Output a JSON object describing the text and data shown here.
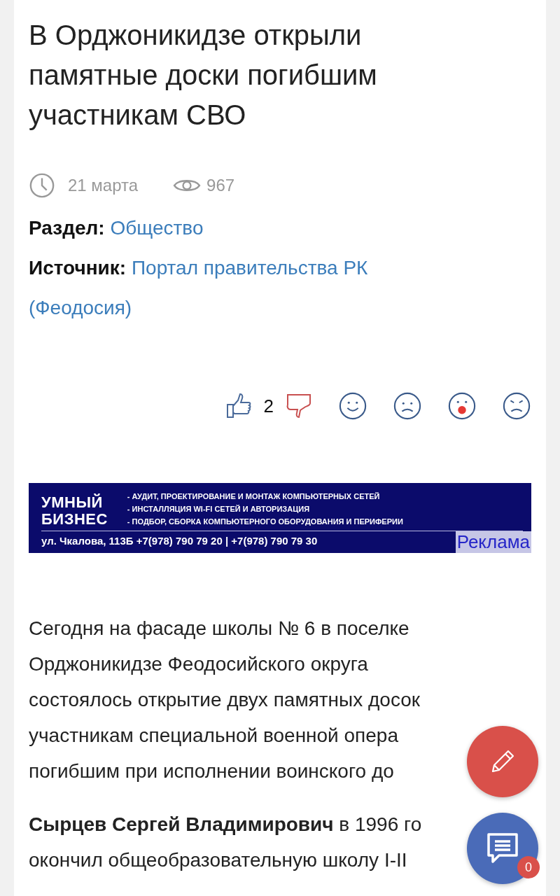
{
  "article": {
    "title": "В Орджоникидзе открыли памятные доски погибшим участникам СВО",
    "date": "21 марта",
    "views": "967",
    "section": {
      "label": "Раздел:",
      "value": "Общество"
    },
    "source": {
      "label": "Источник:",
      "value": "Портал правительства РК (Феодосия)"
    }
  },
  "reactions": {
    "likes": "2"
  },
  "banner": {
    "brand_lines": [
      "УМНЫЙ",
      "БИЗНЕС"
    ],
    "services": [
      "- АУДИТ, ПРОЕКТИРОВАНИЕ И МОНТАЖ КОМПЬЮТЕРНЫХ СЕТЕЙ",
      "- ИНСТАЛЛЯЦИЯ WI-FI СЕТЕЙ И АВТОРИЗАЦИЯ",
      "- ПОДБОР, СБОРКА КОМПЬЮТЕРНОГО ОБОРУДОВАНИЯ И ПЕРИФЕРИИ"
    ],
    "address": "ул. Чкалова, 113Б  +7(978) 790 79 20 | +7(978) 790 79 30",
    "ad_label": "Реклама"
  },
  "body": [
    {
      "lines": [
        "Сегодня на фасаде школы № 6 в поселке",
        "Орджоникидзе Феодосийского округа",
        "состоялось открытие двух памятных досок",
        "участникам специальной военной опера",
        "погибшим при исполнении воинского до"
      ]
    },
    {
      "lines": [
        "**Сырцев Сергей Владимирович** в 1996 го",
        "окончил общеобразовательную школу I-II"
      ]
    }
  ],
  "comments": {
    "count": "0"
  }
}
